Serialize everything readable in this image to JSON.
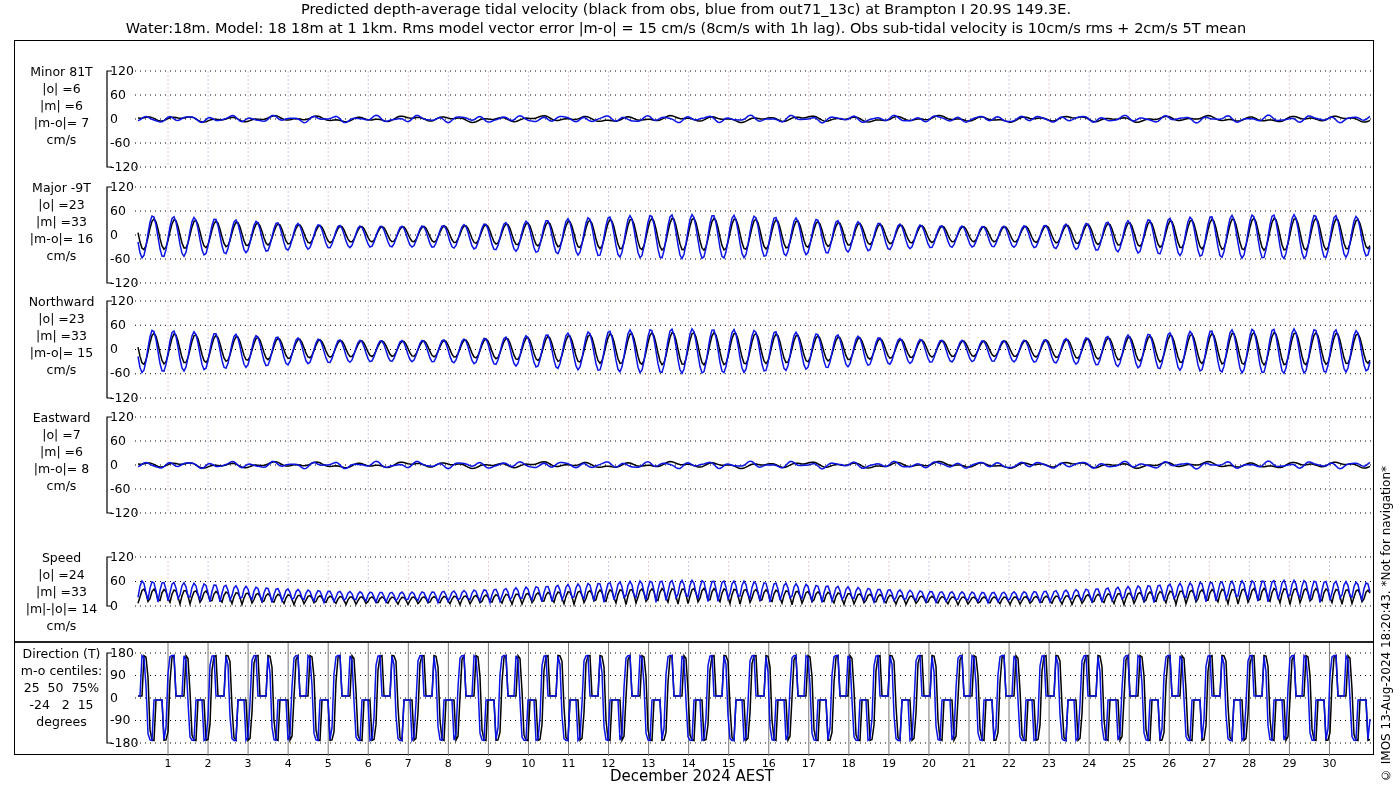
{
  "title_lines": [
    "Predicted depth-average tidal velocity (black from obs, blue from out71_13c) at Brampton I 20.9S 149.3E.",
    "Water:18m. Model: 18 18m at 1 1km. Rms model vector error |m-o| = 15 cm/s (8cm/s with 1h lag). Obs sub-tidal velocity is 10cm/s rms + 2cm/s 5T mean"
  ],
  "panels": [
    {
      "kind": "residual",
      "label_lines": [
        "Minor 81T",
        "|o| =6",
        "|m| =6",
        "|m-o|= 7",
        "cm/s"
      ],
      "yticks": [
        "120",
        "60",
        "0",
        "-60",
        "-120"
      ]
    },
    {
      "kind": "tidal",
      "label_lines": [
        "Major -9T",
        "|o| =23",
        "|m| =33",
        "|m-o|= 16",
        "cm/s"
      ],
      "yticks": [
        "120",
        "60",
        "0",
        "-60",
        "-120"
      ]
    },
    {
      "kind": "tidal",
      "label_lines": [
        "Northward",
        "|o| =23",
        "|m| =33",
        "|m-o|= 15",
        "cm/s"
      ],
      "yticks": [
        "120",
        "60",
        "0",
        "-60",
        "-120"
      ]
    },
    {
      "kind": "residual",
      "label_lines": [
        "Eastward",
        "|o| =7",
        "|m| =6",
        "|m-o|= 8",
        "cm/s"
      ],
      "yticks": [
        "120",
        "60",
        "0",
        "-60",
        "-120"
      ]
    },
    {
      "kind": "speed",
      "label_lines": [
        "Speed",
        "|o| =24",
        "|m| =33",
        "|m|-|o|= 14",
        "cm/s"
      ],
      "yticks": [
        "120",
        "60",
        "0"
      ]
    },
    {
      "kind": "direction",
      "label_lines": [
        "Direction (T)",
        "m-o centiles:",
        "25  50  75%",
        "-24   2  15",
        "degrees"
      ],
      "yticks": [
        "180",
        "90",
        "0",
        "-90",
        "-180"
      ]
    }
  ],
  "x_ticks": [
    "1",
    "2",
    "3",
    "4",
    "5",
    "6",
    "7",
    "8",
    "9",
    "10",
    "11",
    "12",
    "13",
    "14",
    "15",
    "16",
    "17",
    "18",
    "19",
    "20",
    "21",
    "22",
    "23",
    "24",
    "25",
    "26",
    "27",
    "28",
    "29",
    "30"
  ],
  "xlabel": "December 2024 AEST",
  "credit": "© IMOS 13-Aug-2024 18:20:43. *Not for navigation*"
}
